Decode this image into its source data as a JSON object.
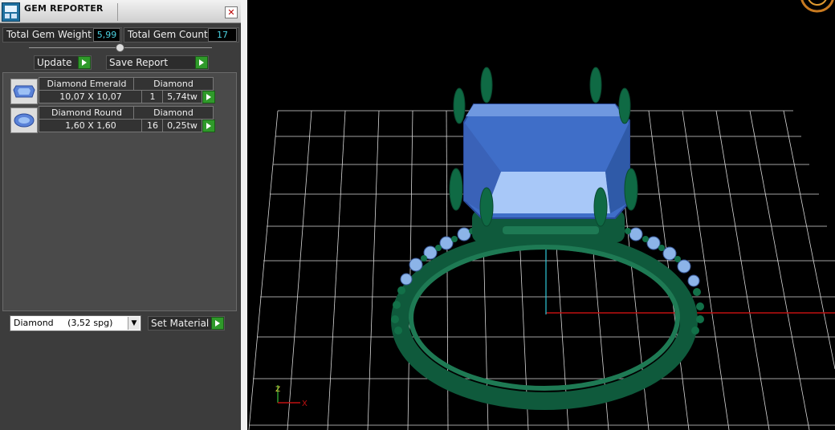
{
  "window": {
    "title": "GEM REPORTER",
    "close_glyph": "✕"
  },
  "stats": {
    "weight_label": "Total Gem Weight",
    "weight_value": "5,99",
    "count_label": "Total Gem Count",
    "count_value": "17"
  },
  "toolbar": {
    "update_label": "Update",
    "save_label": "Save Report"
  },
  "gems": [
    {
      "name": "Diamond Emerald",
      "material": "Diamond",
      "size": "10,07 X 10,07",
      "count": "1",
      "weight": "5,74tw",
      "icon": "emerald-cut-gem-icon"
    },
    {
      "name": "Diamond Round",
      "material": "Diamond",
      "size": "1,60 X 1,60",
      "count": "16",
      "weight": "0,25tw",
      "icon": "round-cut-gem-icon"
    }
  ],
  "material_select": {
    "value": "Diamond     (3,52 spg)",
    "button_label": "Set Material"
  },
  "axis": {
    "x_label": "X",
    "y_label": "Z"
  },
  "colors": {
    "accent_cyan": "#4bd1e0",
    "go_green": "#2f9a2a",
    "ring_green": "#0f5a3c",
    "gem_blue": "#4a78d0",
    "axis_red": "#c01010"
  }
}
